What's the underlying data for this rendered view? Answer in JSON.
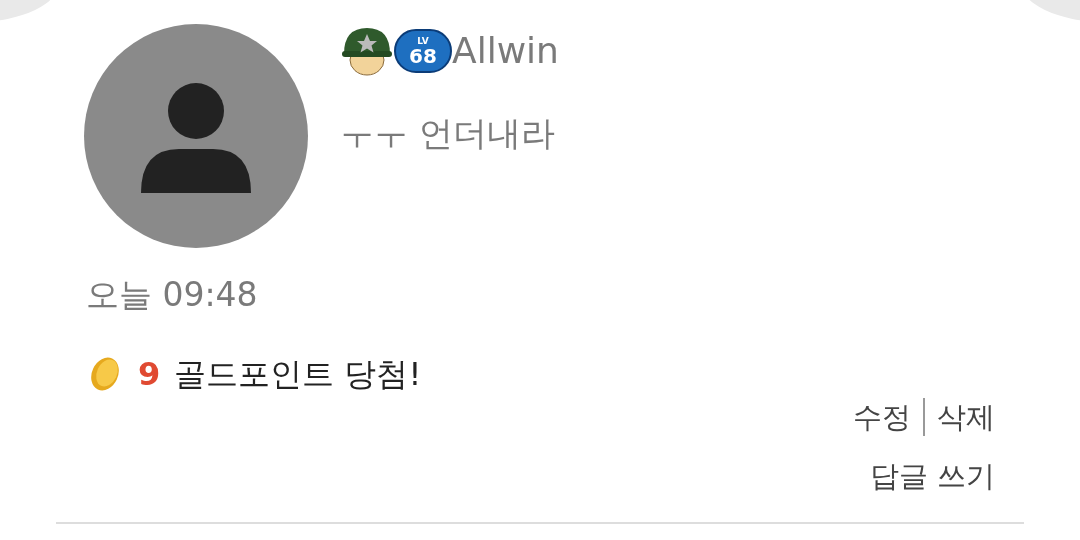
{
  "comment": {
    "author": "Allwin",
    "level_badge": {
      "label": "LV",
      "value": "68"
    },
    "text": "ㅜㅜ 언더내라",
    "time": "오늘 09:48"
  },
  "reward": {
    "amount": "9",
    "text": "골드포인트 당첨!"
  },
  "actions": [
    {
      "label": "수정"
    },
    {
      "label": "삭제"
    }
  ],
  "reply": {
    "label": "답글 쓰기"
  }
}
